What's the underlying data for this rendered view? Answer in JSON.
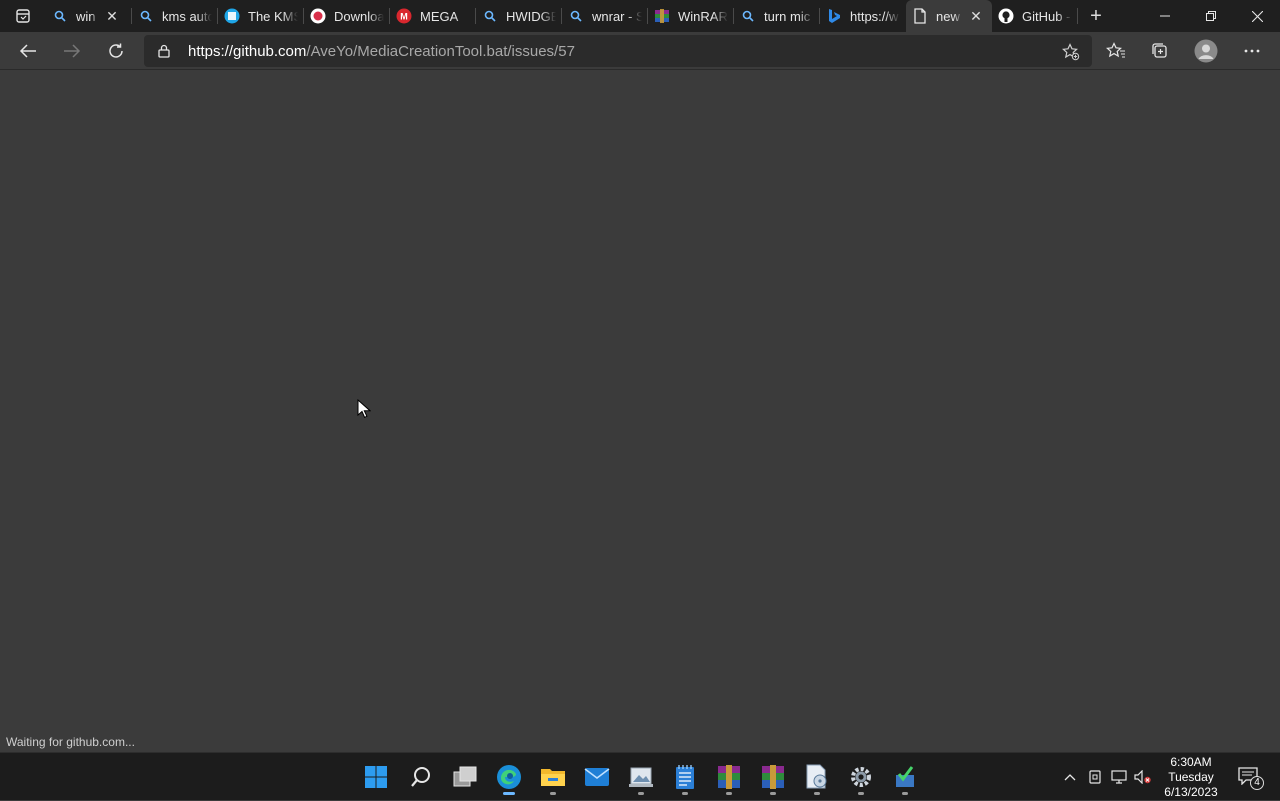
{
  "browser": {
    "tabs": [
      {
        "label": "win",
        "icon": "search-icon",
        "closable": true
      },
      {
        "label": "kms auto",
        "icon": "search-icon"
      },
      {
        "label": "The KMS",
        "icon": "site-icon"
      },
      {
        "label": "Downloa",
        "icon": "site-icon"
      },
      {
        "label": "MEGA",
        "icon": "mega-icon"
      },
      {
        "label": "HWIDGE",
        "icon": "search-icon"
      },
      {
        "label": "wnrar - S",
        "icon": "search-icon"
      },
      {
        "label": "WinRAR",
        "icon": "winrar-icon"
      },
      {
        "label": "turn mic",
        "icon": "search-icon"
      },
      {
        "label": "https://w",
        "icon": "bing-icon"
      },
      {
        "label": "new",
        "icon": "page-icon",
        "active": true,
        "closable": true
      },
      {
        "label": "GitHub -",
        "icon": "github-icon"
      }
    ],
    "address": {
      "host_part": "https://github.com",
      "path_part": "/AveYo/MediaCreationTool.bat/issues/57"
    },
    "status_text": "Waiting for github.com..."
  },
  "taskbar": {
    "clock": {
      "time": "6:30AM",
      "day": "Tuesday",
      "date": "6/13/2023"
    },
    "notification_count": "4"
  },
  "colors": {
    "page_bg": "#3b3b3b",
    "tabstrip_bg": "#1f1f1f",
    "taskbar_bg": "#1c1c1c",
    "accent": "#6cb8ff"
  }
}
